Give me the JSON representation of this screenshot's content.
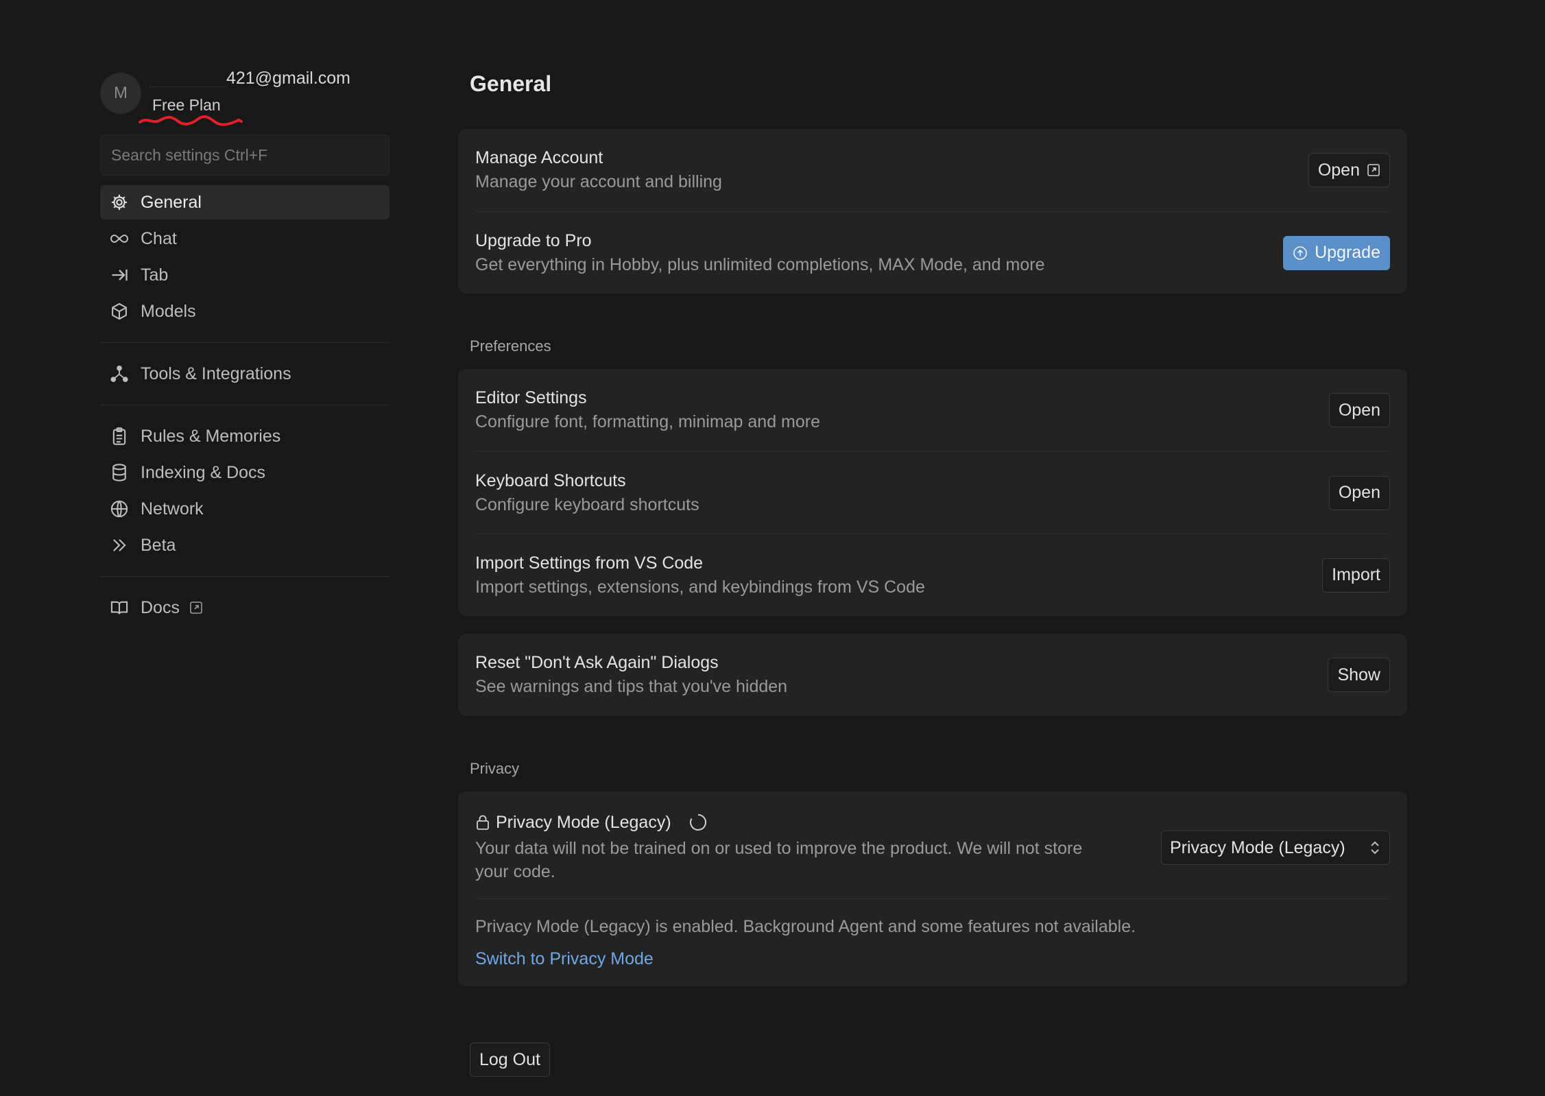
{
  "profile": {
    "avatar_initial": "M",
    "email_visible": "421@gmail.com",
    "plan": "Free Plan"
  },
  "search": {
    "placeholder": "Search settings Ctrl+F"
  },
  "nav": {
    "group1": [
      {
        "label": "General",
        "icon": "gear-icon",
        "active": true
      },
      {
        "label": "Chat",
        "icon": "infinity-icon"
      },
      {
        "label": "Tab",
        "icon": "tab-arrow-icon"
      },
      {
        "label": "Models",
        "icon": "cube-icon"
      }
    ],
    "group2": [
      {
        "label": "Tools & Integrations",
        "icon": "nodes-icon"
      }
    ],
    "group3": [
      {
        "label": "Rules & Memories",
        "icon": "clipboard-icon"
      },
      {
        "label": "Indexing & Docs",
        "icon": "database-icon"
      },
      {
        "label": "Network",
        "icon": "globe-icon"
      },
      {
        "label": "Beta",
        "icon": "double-chevron-icon"
      }
    ],
    "group4": [
      {
        "label": "Docs",
        "icon": "book-icon"
      }
    ]
  },
  "main": {
    "title": "General",
    "account": {
      "manage": {
        "title": "Manage Account",
        "desc": "Manage your account and billing",
        "button": "Open"
      },
      "upgrade": {
        "title": "Upgrade to Pro",
        "desc": "Get everything in Hobby, plus unlimited completions, MAX Mode, and more",
        "button": "Upgrade"
      }
    },
    "preferences_label": "Preferences",
    "preferences": {
      "editor": {
        "title": "Editor Settings",
        "desc": "Configure font, formatting, minimap and more",
        "button": "Open"
      },
      "keyboard": {
        "title": "Keyboard Shortcuts",
        "desc": "Configure keyboard shortcuts",
        "button": "Open"
      },
      "import": {
        "title": "Import Settings from VS Code",
        "desc": "Import settings, extensions, and keybindings from VS Code",
        "button": "Import"
      }
    },
    "reset": {
      "title": "Reset \"Don't Ask Again\" Dialogs",
      "desc": "See warnings and tips that you've hidden",
      "button": "Show"
    },
    "privacy_label": "Privacy",
    "privacy": {
      "title": "Privacy Mode (Legacy)",
      "desc": "Your data will not be trained on or used to improve the product. We will not store your code.",
      "select_value": "Privacy Mode (Legacy)",
      "notice": "Privacy Mode (Legacy) is enabled. Background Agent and some features not available.",
      "link": "Switch to Privacy Mode"
    },
    "logout": "Log Out"
  },
  "colors": {
    "background": "#181818",
    "card": "#232323",
    "accent": "#5b8fc7",
    "link": "#6ea8e6",
    "annotation": "#e0212b"
  }
}
